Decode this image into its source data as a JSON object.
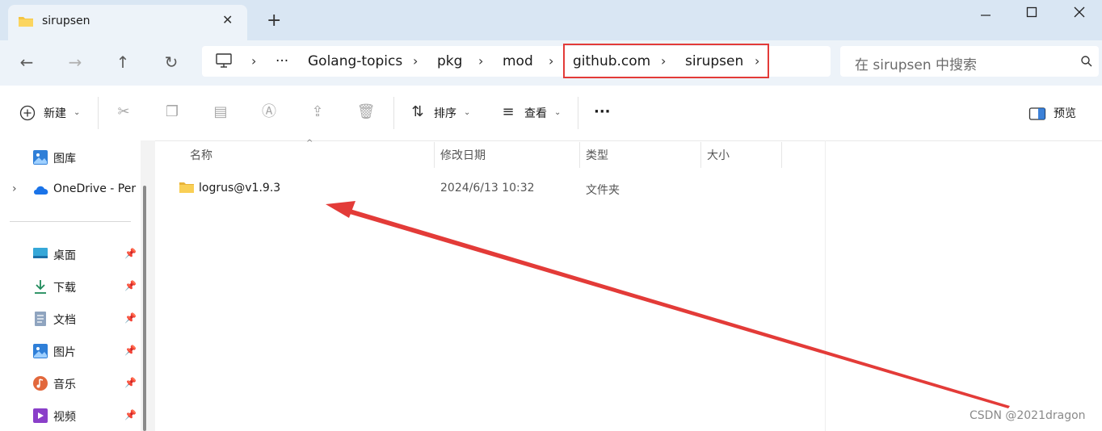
{
  "window": {
    "tab_title": "sirupsen",
    "new_tab": "+",
    "close_tab": "✕"
  },
  "nav": {
    "back": "←",
    "forward": "→",
    "up": "↑",
    "refresh": "↻"
  },
  "address": {
    "ellipsis": "···",
    "crumbs": [
      "Golang-topics",
      "pkg",
      "mod",
      "github.com",
      "sirupsen"
    ],
    "sep": "›"
  },
  "search": {
    "placeholder": "在 sirupsen 中搜索"
  },
  "toolbar": {
    "new_label": "新建",
    "sort_label": "排序",
    "view_label": "查看",
    "more": "···",
    "preview_label": "预览"
  },
  "sidebar": {
    "items": [
      {
        "label": "图库"
      },
      {
        "label": "OneDrive - Per"
      },
      {
        "label": "桌面"
      },
      {
        "label": "下载"
      },
      {
        "label": "文档"
      },
      {
        "label": "图片"
      },
      {
        "label": "音乐"
      },
      {
        "label": "视频"
      }
    ]
  },
  "table": {
    "columns": [
      "名称",
      "修改日期",
      "类型",
      "大小"
    ],
    "rows": [
      {
        "name": "logrus@v1.9.3",
        "date": "2024/6/13 10:32",
        "type": "文件夹",
        "size": ""
      }
    ]
  },
  "watermark": "CSDN @2021dragon",
  "colors": {
    "annotation": "#e33b38",
    "folder": "#f4c542"
  }
}
